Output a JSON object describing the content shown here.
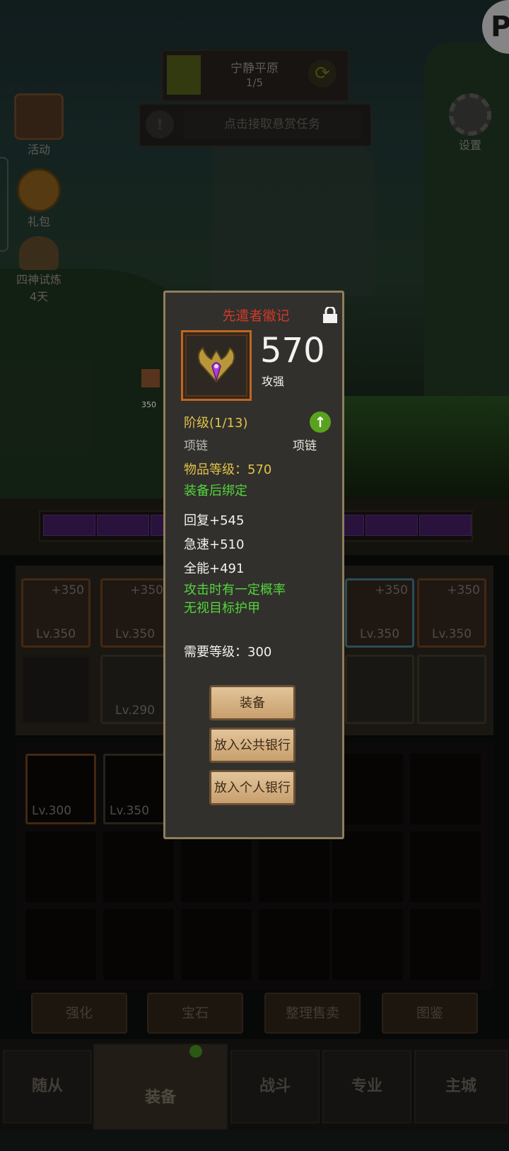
{
  "hud": {
    "stage_name": "宁静平原",
    "stage_progress": "1/5",
    "bounty_text": "点击接取悬赏任务",
    "bounty_icon": "!"
  },
  "sidebar": {
    "activity_label": "活动",
    "gift_label": "礼包",
    "trial_label": "四神试炼",
    "trial_days": "4天",
    "settings_label": "设置"
  },
  "equipment_slots": [
    {
      "plus": "+350",
      "level": "Lv.350"
    },
    {
      "plus": "+350",
      "level": "Lv.350"
    },
    {
      "plus": "+350",
      "level": "Lv.350"
    },
    {
      "plus": "+350",
      "level": "Lv.350"
    },
    {
      "level": "Lv.290"
    }
  ],
  "bag_items": [
    {
      "level": "Lv.300"
    },
    {
      "level": "Lv.350"
    }
  ],
  "side_fragment": {
    "level": "350"
  },
  "function_tabs": [
    "强化",
    "宝石",
    "整理售卖",
    "图鉴"
  ],
  "bottom_nav": [
    "随从",
    "装备",
    "战斗",
    "专业",
    "主城"
  ],
  "item_popup": {
    "name": "先遣者徽记",
    "power": "570",
    "power_label": "攻强",
    "tier": "阶级(1/13)",
    "slot_type": "项链",
    "compare_type": "项链",
    "item_level": "物品等级：570",
    "bind": "装备后绑定",
    "stats": [
      "回复+545",
      "急速+510",
      "全能+491"
    ],
    "effect_line1": "攻击时有一定概率",
    "effect_line2": "无视目标护甲",
    "required_level": "需要等级：300",
    "buttons": {
      "equip": "装备",
      "public_bank": "放入公共银行",
      "personal_bank": "放入个人银行"
    }
  },
  "colors": {
    "title_red": "#d2392a",
    "gold": "#e2c14a",
    "green": "#54d43c",
    "frame": "#8f7e5c"
  }
}
